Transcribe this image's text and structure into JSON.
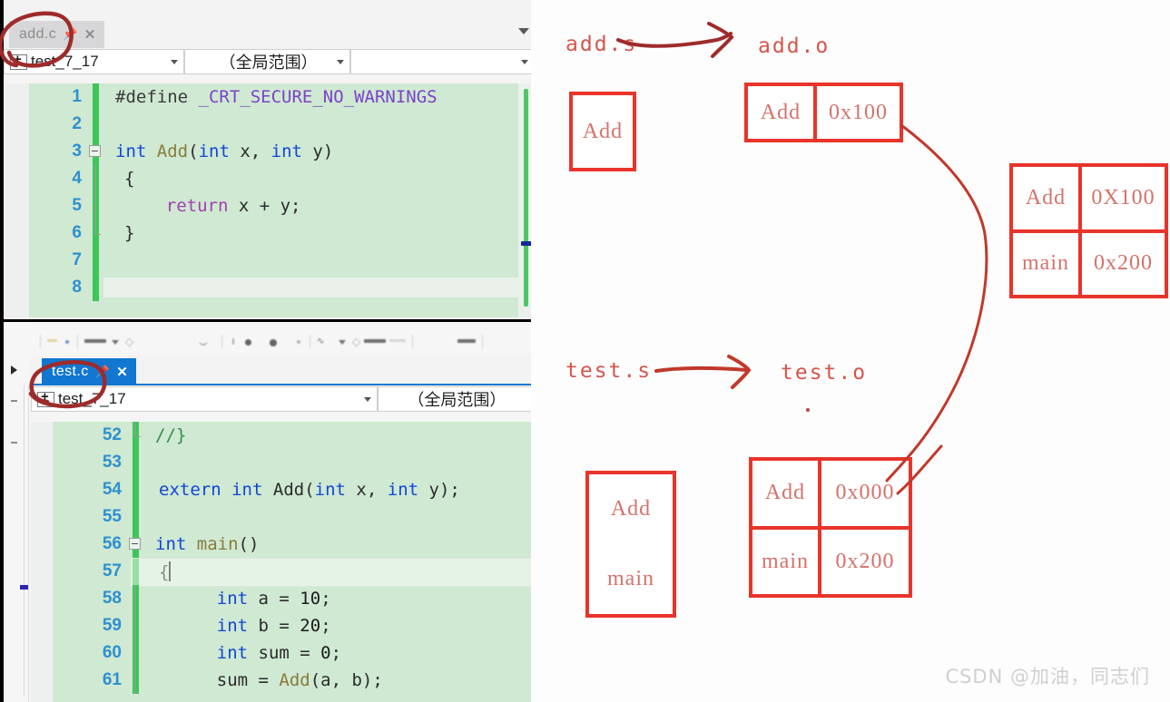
{
  "colors": {
    "annotation_red": "#e8342a",
    "annotation_dark_red": "#9e2b2b",
    "box_text_red": "#d4726b",
    "active_tab_blue": "#1177d1",
    "code_bg_green": "#cfe9d2",
    "change_bar_green": "#3ec65a",
    "line_number_blue": "#2f8fd0",
    "watermark_gray": "#cfcfcf"
  },
  "editors": [
    {
      "id": "top",
      "tab": {
        "label": "add.c",
        "state": "inactive",
        "pin_icon": "pin-icon",
        "close_icon": "close-icon"
      },
      "tabrow_dropdown_icon": "chevron-down-icon",
      "nav": {
        "project": "test_7_17",
        "project_icon": "project-node-icon",
        "scope": "（全局范围）",
        "member": "",
        "dropdown_icon": "chevron-down-small-icon"
      },
      "lines": [
        {
          "n": "1",
          "tokens": [
            {
              "t": "#define ",
              "c": "pre"
            },
            {
              "t": "_CRT_SECURE_NO_WARNINGS",
              "c": "macro"
            }
          ],
          "indent": 18
        },
        {
          "n": "2",
          "tokens": [],
          "indent": 18
        },
        {
          "n": "3",
          "tokens": [
            {
              "t": "int",
              "c": "kw"
            },
            {
              "t": " ",
              "c": "plain"
            },
            {
              "t": "Add",
              "c": "fn"
            },
            {
              "t": "(",
              "c": "plain"
            },
            {
              "t": "int",
              "c": "kw"
            },
            {
              "t": " x, ",
              "c": "ident"
            },
            {
              "t": "int",
              "c": "kw"
            },
            {
              "t": " y)",
              "c": "ident"
            }
          ],
          "indent": 18,
          "fold": "open"
        },
        {
          "n": "4",
          "tokens": [
            {
              "t": "{",
              "c": "plain"
            }
          ],
          "indent": 28,
          "foldline": true
        },
        {
          "n": "5",
          "tokens": [
            {
              "t": "    ",
              "c": "plain"
            },
            {
              "t": "return",
              "c": "flow"
            },
            {
              "t": " x + y;",
              "c": "ident"
            }
          ],
          "indent": 28,
          "foldline": true
        },
        {
          "n": "6",
          "tokens": [
            {
              "t": "}",
              "c": "plain"
            }
          ],
          "indent": 28,
          "foldend": true
        },
        {
          "n": "7",
          "tokens": [],
          "indent": 18
        },
        {
          "n": "8",
          "tokens": [],
          "indent": 18,
          "blank_box": true
        }
      ]
    },
    {
      "id": "bottom",
      "tab": {
        "label": "test.c",
        "state": "active",
        "pin_icon": "pin-icon",
        "close_icon": "close-icon"
      },
      "nav": {
        "project": "test_7_17",
        "project_icon": "project-node-icon",
        "scope": "（全局范围）",
        "dropdown_icon": "chevron-down-small-icon"
      },
      "lines": [
        {
          "n": "52",
          "tokens": [
            {
              "t": "//}",
              "c": "cmt"
            }
          ],
          "indent": 18,
          "foldend": true
        },
        {
          "n": "53",
          "tokens": [],
          "indent": 18
        },
        {
          "n": "54",
          "tokens": [
            {
              "t": "extern",
              "c": "kw"
            },
            {
              "t": " ",
              "c": "plain"
            },
            {
              "t": "int",
              "c": "kw"
            },
            {
              "t": " ",
              "c": "plain"
            },
            {
              "t": "Add",
              "c": "ident"
            },
            {
              "t": "(",
              "c": "plain"
            },
            {
              "t": "int",
              "c": "kw"
            },
            {
              "t": " x, ",
              "c": "ident"
            },
            {
              "t": "int",
              "c": "kw"
            },
            {
              "t": " y);",
              "c": "ident"
            }
          ],
          "indent": 22
        },
        {
          "n": "55",
          "tokens": [],
          "indent": 18
        },
        {
          "n": "56",
          "tokens": [
            {
              "t": "int",
              "c": "kw"
            },
            {
              "t": " ",
              "c": "plain"
            },
            {
              "t": "main",
              "c": "fn"
            },
            {
              "t": "()",
              "c": "plain"
            }
          ],
          "indent": 18,
          "fold": "open"
        },
        {
          "n": "57",
          "tokens": [
            {
              "t": "{",
              "c": "plain"
            }
          ],
          "indent": 22,
          "cursor": true,
          "current": true
        },
        {
          "n": "58",
          "tokens": [
            {
              "t": "    ",
              "c": "plain"
            },
            {
              "t": "int",
              "c": "kw"
            },
            {
              "t": " a = ",
              "c": "ident"
            },
            {
              "t": "10",
              "c": "num"
            },
            {
              "t": ";",
              "c": "ident"
            }
          ],
          "indent": 40,
          "foldline": true
        },
        {
          "n": "59",
          "tokens": [
            {
              "t": "    ",
              "c": "plain"
            },
            {
              "t": "int",
              "c": "kw"
            },
            {
              "t": " b = ",
              "c": "ident"
            },
            {
              "t": "20",
              "c": "num"
            },
            {
              "t": ";",
              "c": "ident"
            }
          ],
          "indent": 40,
          "foldline": true
        },
        {
          "n": "60",
          "tokens": [
            {
              "t": "    ",
              "c": "plain"
            },
            {
              "t": "int",
              "c": "kw"
            },
            {
              "t": " sum = ",
              "c": "ident"
            },
            {
              "t": "0",
              "c": "num"
            },
            {
              "t": ";",
              "c": "ident"
            }
          ],
          "indent": 40,
          "foldline": true
        },
        {
          "n": "61",
          "tokens": [
            {
              "t": "    sum = ",
              "c": "ident"
            },
            {
              "t": "Add",
              "c": "fn"
            },
            {
              "t": "(a, b);",
              "c": "ident"
            }
          ],
          "indent": 40,
          "foldline": true
        }
      ]
    }
  ],
  "diagram": {
    "labels": {
      "add_s": "add.s",
      "add_o": "add.o",
      "test_s": "test.s",
      "test_o": "test.o"
    },
    "add_box_top": {
      "cells": [
        "Add"
      ]
    },
    "add_o_table": {
      "rows": [
        {
          "symbol": "Add",
          "address": "0x100"
        }
      ]
    },
    "link_table": {
      "rows": [
        {
          "symbol": "Add",
          "address": "0X100"
        },
        {
          "symbol": "main",
          "address": "0x200"
        }
      ]
    },
    "test_box_bottom": {
      "cells": [
        "Add",
        "main"
      ]
    },
    "test_o_table": {
      "rows": [
        {
          "symbol": "Add",
          "address": "0x000"
        },
        {
          "symbol": "main",
          "address": "0x200"
        }
      ]
    },
    "arrows": [
      {
        "name": "add-s-to-add-o-arrow",
        "from": "add.s",
        "to": "add.o"
      },
      {
        "name": "test-s-to-test-o-arrow",
        "from": "test.s",
        "to": "test.o"
      },
      {
        "name": "link-curve-arrow",
        "from": "add.o table",
        "to": "link table"
      },
      {
        "name": "link-curve-arrow-2",
        "from": "test.o table",
        "to": "link table"
      }
    ],
    "circles": [
      {
        "name": "add-c-tab-circle",
        "target": "add.c tab"
      },
      {
        "name": "test-c-tab-circle",
        "target": "test.c tab"
      }
    ]
  },
  "watermark": "CSDN @加油，同志们"
}
